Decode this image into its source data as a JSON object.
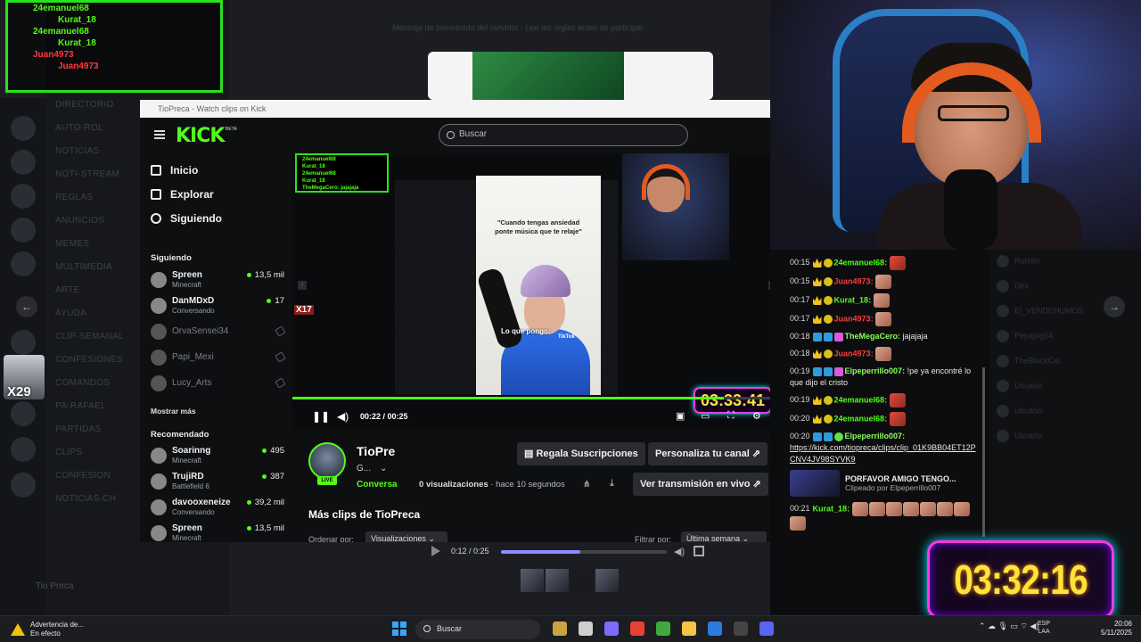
{
  "top_left_overlay": {
    "lines": [
      {
        "text": "24emanuel68",
        "color": "#53fc18"
      },
      {
        "text": "Kurat_18",
        "color": "#53fc18"
      },
      {
        "text": "24emanuel68",
        "color": "#53fc18"
      },
      {
        "text": "Kurat_18",
        "color": "#53fc18"
      },
      {
        "text": "Juan4973",
        "color": "#ff3b3b"
      },
      {
        "text": "Juan4973",
        "color": "#ff3b3b"
      }
    ]
  },
  "bg_app": {
    "channels": [
      "DIRECTORIO",
      "AUTO-ROL",
      "NOTICIAS",
      "NOTI-STREAM",
      "REGLAS",
      "ANUNCIOS",
      "MEMES",
      "MULTIMEDIA",
      "ARTE",
      "AYUDA",
      "CLIP-SEMANAL",
      "CONFESIONES",
      "COMANDOS",
      "PA-RAFAEL",
      "PARTIDAS",
      "CLIPS",
      "CONFESION",
      "NOTICIAS-CH"
    ],
    "banner": "Mensaje de bienvenida del servidor · Lee las reglas antes de participar",
    "footer_user": "Tio Preca",
    "members": [
      "Rufelio",
      "Dex",
      "El_VENDEHUMOS",
      "Pepapig04",
      "TheBlackCat",
      "Usuario",
      "Usuario",
      "Usuario"
    ]
  },
  "window": {
    "title": "TioPreca - Watch clips on Kick"
  },
  "kick": {
    "logo": "KICK",
    "beta": "BETA",
    "search_placeholder": "Buscar",
    "nav": [
      {
        "label": "Inicio",
        "icon": "home-icon"
      },
      {
        "label": "Explorar",
        "icon": "compass-icon"
      },
      {
        "label": "Siguiendo",
        "icon": "heart-icon"
      }
    ],
    "following_title": "Siguiendo",
    "following": [
      {
        "name": "Spreen",
        "category": "Minecraft",
        "viewers": "13,5 mil",
        "live": true
      },
      {
        "name": "DanMDxD",
        "category": "Conversando",
        "viewers": "17",
        "live": true
      },
      {
        "name": "OrvaSensei34",
        "live": false
      },
      {
        "name": "Papi_Mexi",
        "live": false
      },
      {
        "name": "Lucy_Arts",
        "live": false
      }
    ],
    "show_more": "Mostrar más",
    "recommended_title": "Recomendado",
    "recommended": [
      {
        "name": "Soarinng",
        "category": "Minecraft",
        "viewers": "495"
      },
      {
        "name": "TrujiRD",
        "category": "Battlefield 6",
        "viewers": "387"
      },
      {
        "name": "davooxeneize",
        "category": "Conversando",
        "viewers": "39,2 mil"
      },
      {
        "name": "Spreen",
        "category": "Minecraft",
        "viewers": "13,5 mil"
      }
    ]
  },
  "player": {
    "inner_chat": [
      "24emanuel68",
      "Kurat_18",
      "24emanuel68",
      "Kurat_18",
      "TheMegaCero: jajajaja"
    ],
    "tiktok_caption": "\"Cuando tengas ansiedad ponte música que te relaje\"",
    "tiktok_overlay": "Lo que pongo:",
    "tiktok_logo": "TikTok",
    "badge_x17": "X17",
    "stream_timer": "03:33:41",
    "time_current": "00:22",
    "time_total": "00:25",
    "time_text": "00:22 / 00:25",
    "progress": 0.88
  },
  "clip_info": {
    "channel": "TioPre",
    "sub": "G...",
    "category": "Conversa",
    "live_badge": "LIVE",
    "views_count": "0",
    "views_label": "visualizaciones",
    "age": "· hace 10 segundos",
    "btn_gift": "Regala Suscripciones",
    "btn_customize": "Personaliza tu canal",
    "btn_watch_live": "Ver transmisión en vivo",
    "more_clips": "Más clips de TioPreca",
    "order_label": "Ordenar por:",
    "order_value": "Visualizaciones",
    "filter_label": "Filtrar por:",
    "filter_value": "Última semana"
  },
  "chat": {
    "messages": [
      {
        "time": "00:15",
        "user": "24emanuel68",
        "color": "green",
        "text": "",
        "emotes": 1,
        "emote_color": "red"
      },
      {
        "time": "00:15",
        "user": "Juan4973",
        "color": "red",
        "text": "",
        "emotes": 1
      },
      {
        "time": "00:17",
        "user": "Kurat_18",
        "color": "green",
        "text": "",
        "emotes": 1
      },
      {
        "time": "00:17",
        "user": "Juan4973",
        "color": "red",
        "text": "",
        "emotes": 1
      },
      {
        "time": "00:18",
        "user": "TheMegaCero",
        "color": "lgreen",
        "text": "jajajaja",
        "emotes": 0
      },
      {
        "time": "00:18",
        "user": "Juan4973",
        "color": "red",
        "text": "",
        "emotes": 1
      },
      {
        "time": "00:19",
        "user": "Elpeperrillo007",
        "color": "lgreen",
        "text": "!pe ya encontré lo que dijo el cristo",
        "emotes": 0
      },
      {
        "time": "00:19",
        "user": "24emanuel68",
        "color": "green",
        "text": "",
        "emotes": 1,
        "emote_color": "red"
      },
      {
        "time": "00:20",
        "user": "24emanuel68",
        "color": "green",
        "text": "",
        "emotes": 1,
        "emote_color": "red"
      }
    ],
    "link_msg": {
      "time": "00:20",
      "user": "Elpeperrillo007",
      "link": "https://kick.com/tiopreca/clips/clip_01K9BB04ET12PCNV4JV98SYVK9"
    },
    "clip_title": "PORFAVOR AMIGO TENGO...",
    "clip_by": "Clipeado por Elpeperrillo007",
    "last_msg": {
      "time": "00:21",
      "user": "Kurat_18",
      "emotes": 8
    }
  },
  "overlay_timer": "03:32:16",
  "outer_player": {
    "time": "0:12 / 0:25",
    "progress": 0.48
  },
  "x29_badge": "X29",
  "taskbar": {
    "warning_title": "Advertencia de...",
    "warning_sub": "En efecto",
    "search": "Buscar",
    "lang_line1": "ESP",
    "lang_line2": "LAA",
    "time": "20:06",
    "date": "5/11/2025",
    "apps": [
      {
        "name": "game-app-icon",
        "color": "#c9a441"
      },
      {
        "name": "task-view-icon",
        "color": "#cfcfcf"
      },
      {
        "name": "copilot-icon",
        "color": "#7b6cff"
      },
      {
        "name": "chrome-icon",
        "color": "#e84235"
      },
      {
        "name": "minecraft-icon",
        "color": "#3fa93f"
      },
      {
        "name": "folder-icon",
        "color": "#f4c542"
      },
      {
        "name": "store-icon",
        "color": "#2d7be0"
      },
      {
        "name": "obs-icon",
        "color": "#444"
      },
      {
        "name": "discord-icon",
        "color": "#5865f2"
      }
    ]
  }
}
